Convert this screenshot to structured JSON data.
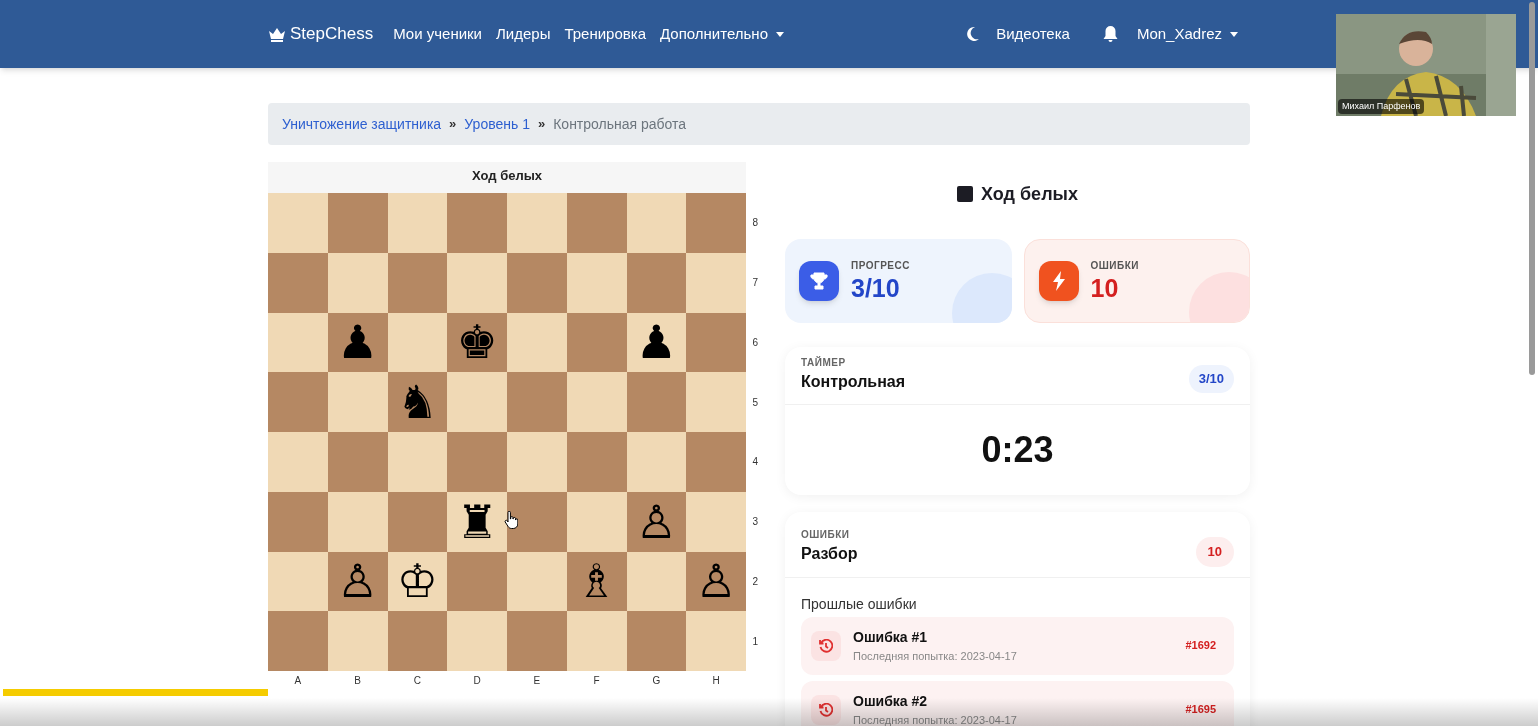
{
  "navbar": {
    "brand": "StepChess",
    "links": [
      {
        "label": "Мои ученики",
        "dropdown": false
      },
      {
        "label": "Лидеры",
        "dropdown": false
      },
      {
        "label": "Тренировка",
        "dropdown": false
      },
      {
        "label": "Дополнительно",
        "dropdown": true
      }
    ],
    "library": "Видеотека",
    "user": "Mon_Xadrez"
  },
  "breadcrumb": [
    {
      "label": "Уничтожение защитника",
      "current": false
    },
    {
      "separator": "»",
      "label": "Уровень 1",
      "current": false
    },
    {
      "separator": "»",
      "label": "Контрольная работа",
      "current": true
    }
  ],
  "board": {
    "header": "Ход белых",
    "files": [
      "A",
      "B",
      "C",
      "D",
      "E",
      "F",
      "G",
      "H"
    ],
    "ranks": [
      "8",
      "7",
      "6",
      "5",
      "4",
      "3",
      "2",
      "1"
    ],
    "rows": [
      [
        {},
        {},
        {},
        {},
        {},
        {},
        {},
        {}
      ],
      [
        {},
        {},
        {},
        {},
        {},
        {},
        {},
        {}
      ],
      [
        {},
        {
          "piece": "♟"
        },
        {},
        {
          "piece": "♚"
        },
        {},
        {},
        {
          "piece": "♟"
        },
        {}
      ],
      [
        {},
        {},
        {
          "piece": "♞"
        },
        {},
        {},
        {},
        {},
        {}
      ],
      [
        {},
        {},
        {},
        {},
        {},
        {},
        {},
        {}
      ],
      [
        {},
        {},
        {},
        {
          "piece": "♜"
        },
        {},
        {},
        {
          "piece": "♙"
        },
        {}
      ],
      [
        {},
        {
          "piece": "♙"
        },
        {
          "piece": "♔"
        },
        {},
        {},
        {
          "piece": "♗"
        },
        {},
        {
          "piece": "♙"
        }
      ],
      [
        {},
        {},
        {},
        {},
        {},
        {},
        {},
        {}
      ]
    ]
  },
  "turn": "Ход белых",
  "stats": [
    {
      "kind": "progress",
      "label": "ПРОГРЕСС",
      "value": "3/10"
    },
    {
      "kind": "errors",
      "label": "ОШИБКИ",
      "value": "10"
    }
  ],
  "timer": {
    "caption": "ТАЙМЕР",
    "title": "Контрольная",
    "badge": "3/10",
    "time": "0:23"
  },
  "errors": {
    "caption": "ОШИБКИ",
    "title": "Разбор",
    "badge": "10",
    "subheading": "Прошлые ошибки",
    "items": [
      {
        "title": "Ошибка #1",
        "subtitle": "Последняя попытка: 2023-04-17",
        "id": "#1692"
      },
      {
        "title": "Ошибка #2",
        "subtitle": "Последняя попытка: 2023-04-17",
        "id": "#1695"
      }
    ]
  },
  "webcam": {
    "name": "Михаил Парфенов"
  },
  "video": {
    "level": 0.173
  }
}
